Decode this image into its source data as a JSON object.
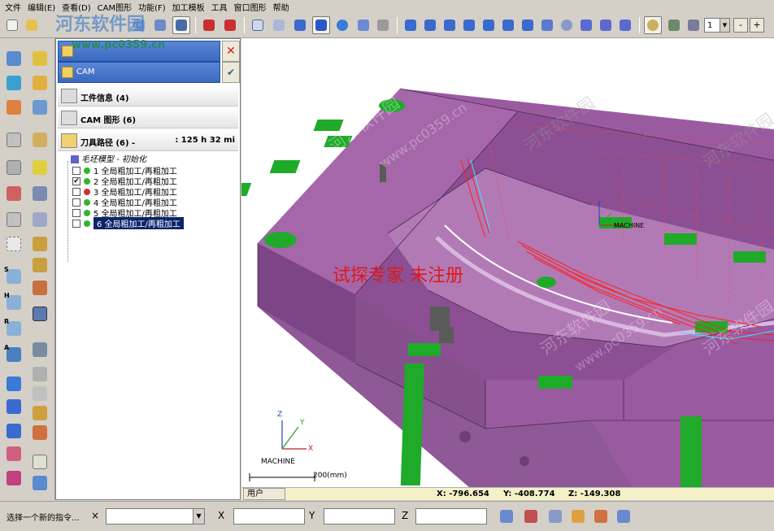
{
  "menu": {
    "items": [
      "文件",
      "编辑(E)",
      "查看(D)",
      "CAM图形",
      "功能(F)",
      "加工模板",
      "工具",
      "窗口图形",
      "帮助"
    ]
  },
  "toolbar": {
    "layer_value": "1",
    "minus": "-",
    "plus": "+"
  },
  "panel": {
    "tab_blank": "",
    "tab_cam": "CAM",
    "sections": {
      "workpiece": "工件信息 (4)",
      "cam_graphics": "CAM 图形 (6)",
      "toolpath": "刀具路径 (6) -",
      "toolpath_time": ": 125 h 32 mi"
    },
    "tree_root": "毛坯模型 - 初始化",
    "operations": [
      {
        "label": "1 全局粗加工/再粗加工",
        "checked": false,
        "color": "#2fb52f"
      },
      {
        "label": "2 全局粗加工/再粗加工",
        "checked": true,
        "color": "#2fb52f"
      },
      {
        "label": "3 全局粗加工/再粗加工",
        "checked": false,
        "color": "#d03030"
      },
      {
        "label": "4 全局粗加工/再粗加工",
        "checked": false,
        "color": "#2fb52f"
      },
      {
        "label": "5 全局粗加工/再粗加工",
        "checked": false,
        "color": "#2fb52f"
      },
      {
        "label": "6 全局粗加工/再粗加工",
        "checked": false,
        "color": "#2fb52f"
      }
    ]
  },
  "viewport": {
    "watermark_red": "试探专家 未注册",
    "machine_label": "MACHINE",
    "machine_label_2": "MACHINE",
    "scale_label": "200(mm)",
    "axis_x": "X",
    "axis_y": "Y",
    "axis_z": "Z",
    "watermarks": [
      "河东软件园",
      "www.pc0359.cn"
    ]
  },
  "status": {
    "user_tab": "用户",
    "x": "X: -796.654",
    "y": "Y: -408.774",
    "z": "Z: -149.308"
  },
  "command_bar": {
    "prompt": "选择一个新的指令...",
    "close": "×",
    "x_label": "X",
    "y_label": "Y",
    "z_label": "Z"
  },
  "site_watermark": {
    "logo": "河东软件园",
    "url": "www.pc0359.cn"
  }
}
